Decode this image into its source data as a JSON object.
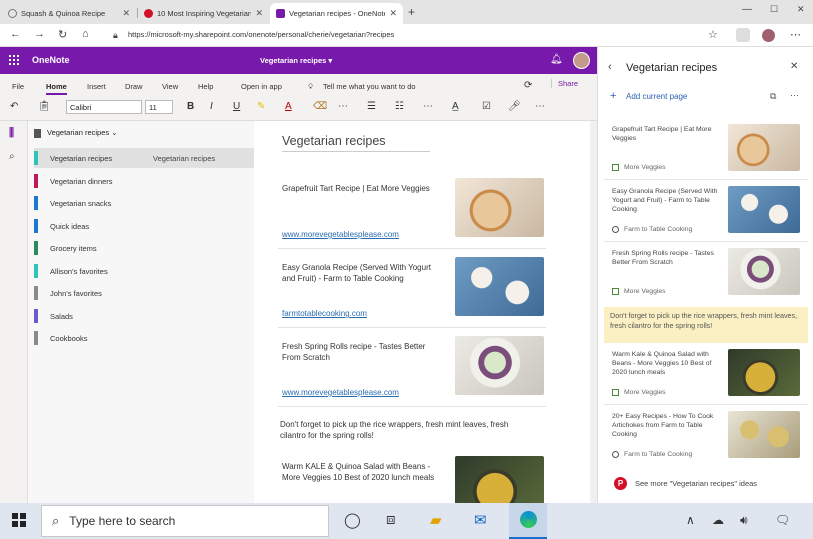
{
  "browser": {
    "tabs": [
      {
        "title": "Squash & Quinoa Recipe",
        "fav": "#9b9b9b"
      },
      {
        "title": "10 Most Inspiring Vegetarian Re",
        "fav": "#d50f25"
      },
      {
        "title": "Vegetarian recipes - OneNote",
        "fav": "#7719aa"
      }
    ],
    "new_tab": "+",
    "url": "https://microsoft-my.sharepoint.com/onenote/personal/cherie/vegetarian?recipes"
  },
  "onenote": {
    "brand": "OneNote",
    "notebook_title": "Vegetarian recipes ▾",
    "ribbon_tabs": [
      "File",
      "Home",
      "Insert",
      "Draw",
      "View",
      "Help",
      "Open in app"
    ],
    "tell_me": "Tell me what you want to do",
    "share": "Share",
    "font": "Calibri",
    "size": "11"
  },
  "notebook": {
    "name": "Vegetarian recipes",
    "sections": [
      {
        "label": "Vegetarian recipes",
        "color": "#2ec4b6"
      },
      {
        "label": "Vegetarian dinners",
        "color": "#c2185b"
      },
      {
        "label": "Vegetarian snacks",
        "color": "#1f77d0"
      },
      {
        "label": "Quick ideas",
        "color": "#1f77d0"
      },
      {
        "label": "Grocery items",
        "color": "#2e8b57"
      },
      {
        "label": "Allison's favorites",
        "color": "#2ec4b6"
      },
      {
        "label": "John's favorites",
        "color": "#8a8a8a"
      },
      {
        "label": "Salads",
        "color": "#6a5acd"
      },
      {
        "label": "Cookbooks",
        "color": "#8a8a8a"
      }
    ],
    "page": "Vegetarian recipes"
  },
  "page": {
    "title": "Vegetarian recipes",
    "cards": [
      {
        "title": "Grapefruit Tart Recipe | Eat More Veggies",
        "link": "www.morevegetablesplease.com"
      },
      {
        "title": "Easy Granola Recipe (Served With Yogurt and Fruit) - Farm to Table Cooking",
        "link": "farmtotablecooking.com"
      },
      {
        "title": "Fresh Spring Rolls recipe - Tastes Better From Scratch",
        "link": "www.morevegetablesplease.com"
      },
      {
        "title": "Warm KALE & Quinoa Salad with Beans - More Veggies 10 Best of 2020 lunch meals",
        "link": ""
      }
    ],
    "note": "Don't forget to pick up the rice wrappers, fresh mint leaves, fresh cilantro for the spring rolls!"
  },
  "panel": {
    "title": "Vegetarian recipes",
    "add_current": "Add current page",
    "items": [
      {
        "title": "Grapefruit Tart Recipe | Eat More Veggies",
        "source": "More Veggies",
        "icon": "square"
      },
      {
        "title": "Easy Granola Recipe (Served With Yogurt and Fruit) - Farm to Table Cooking",
        "source": "Farm to Table Cooking",
        "icon": "circle"
      },
      {
        "title": "Fresh Spring Rolls recipe - Tastes Better From Scratch",
        "source": "More Veggies",
        "icon": "square"
      },
      {
        "title": "Warm Kale & Quinoa Salad with Beans - More Veggies 10 Best of 2020 lunch meals",
        "source": "More Veggies",
        "icon": "square"
      },
      {
        "title": "20+ Easy Recipes - How To Cook Artichokes from Farm to Table Cooking",
        "source": "Farm to Table Cooking",
        "icon": "circle"
      }
    ],
    "note": "Don't forget to pick up the rice wrappers, fresh mint leaves, fresh cilantro for the spring rolls!",
    "see_more": "See more \"Vegetarian recipes\" ideas"
  },
  "taskbar": {
    "search_placeholder": "Type here to search"
  }
}
